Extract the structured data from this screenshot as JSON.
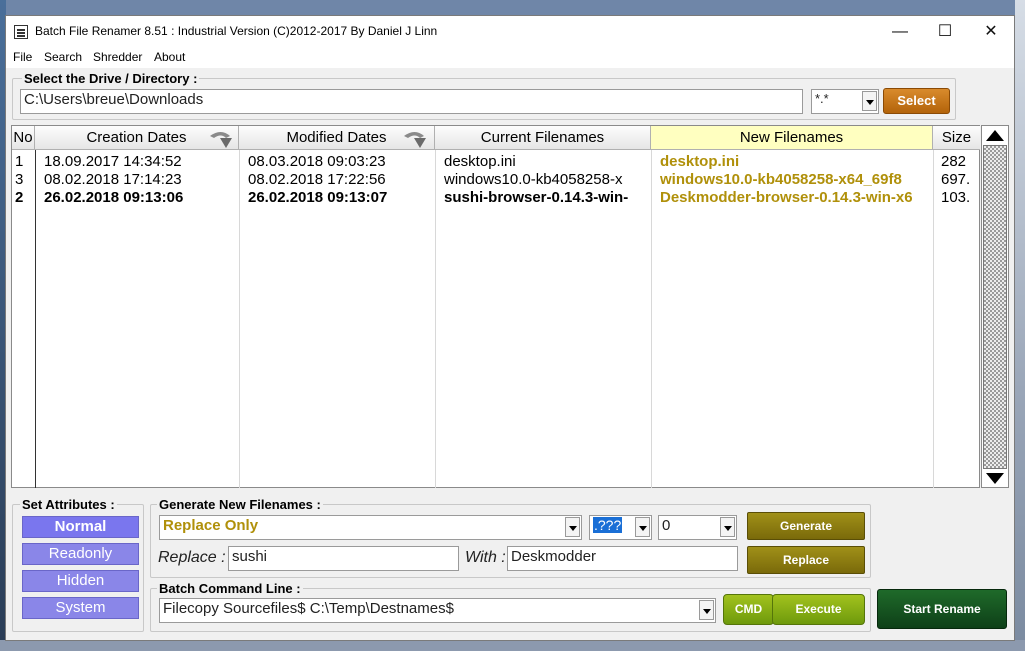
{
  "window": {
    "title": "Batch File Renamer 8.51 : Industrial Version (C)2012-2017 By Daniel J Linn",
    "controls": {
      "minimize": "—",
      "maximize": "☐",
      "close": "✕"
    }
  },
  "menu": [
    "File",
    "Search",
    "Shredder",
    "About"
  ],
  "directory": {
    "label": "Select the Drive / Directory :",
    "path": "C:\\Users\\breue\\Downloads",
    "filter": "*.*",
    "select_button": "Select"
  },
  "grid": {
    "columns": [
      "No",
      "Creation Dates",
      "Modified Dates",
      "Current Filenames",
      "New Filenames",
      "Size"
    ],
    "rows": [
      {
        "no": "1",
        "created": "18.09.2017 14:34:52",
        "modified": "08.03.2018 09:03:23",
        "current": "desktop.ini",
        "new": "desktop.ini",
        "size": "282",
        "bold": false
      },
      {
        "no": "3",
        "created": "08.02.2018 17:14:23",
        "modified": "08.02.2018 17:22:56",
        "current": "windows10.0-kb4058258-x",
        "new": "windows10.0-kb4058258-x64_69f8",
        "size": "697.",
        "bold": false
      },
      {
        "no": "2",
        "created": "26.02.2018 09:13:06",
        "modified": "26.02.2018 09:13:07",
        "current": "sushi-browser-0.14.3-win-",
        "new": "Deskmodder-browser-0.14.3-win-x6",
        "size": "103.",
        "bold": true
      }
    ]
  },
  "attributes": {
    "label": "Set Attributes :",
    "buttons": [
      "Normal",
      "Readonly",
      "Hidden",
      "System"
    ],
    "active": "Normal"
  },
  "generate": {
    "label": "Generate New Filenames  :",
    "mode": "Replace Only",
    "pattern": ".???",
    "counter": "0",
    "generate_button": "Generate",
    "replace_label": "Replace :",
    "replace_value": "sushi",
    "with_label": "With :",
    "with_value": "Deskmodder",
    "replace_button": "Replace"
  },
  "batch": {
    "label": "Batch Command Line :",
    "command": "Filecopy Sourcefiles$ C:\\Temp\\Destnames$",
    "cmd_button": "CMD",
    "execute_button": "Execute"
  },
  "start_button": "Start Rename",
  "colors": {
    "new_filename_text": "#b0900a",
    "new_filename_header": "#ffffc0",
    "select_button": "#c8740f",
    "attr_button": "#8a86e8",
    "start_button": "#145a20"
  }
}
